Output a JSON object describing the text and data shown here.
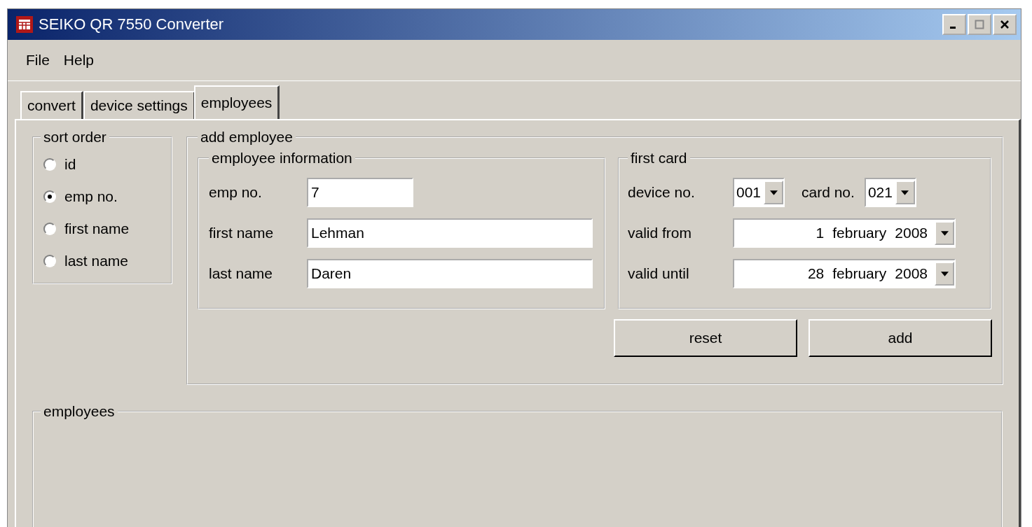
{
  "window": {
    "title": "SEIKO QR 7550 Converter"
  },
  "menu": [
    "File",
    "Help"
  ],
  "tabs": [
    {
      "label": "convert",
      "selected": false
    },
    {
      "label": "device settings",
      "selected": false
    },
    {
      "label": "employees",
      "selected": true
    }
  ],
  "sort_order": {
    "title": "sort order",
    "options": [
      {
        "label": "id",
        "selected": false
      },
      {
        "label": "emp no.",
        "selected": true
      },
      {
        "label": "first name",
        "selected": false
      },
      {
        "label": "last name",
        "selected": false
      }
    ]
  },
  "add_employee": {
    "title": "add employee",
    "employee_information": {
      "title": "employee information",
      "fields": [
        {
          "label": "emp no.",
          "value": "7",
          "kind": "short"
        },
        {
          "label": "first name",
          "value": "Lehman",
          "kind": "long"
        },
        {
          "label": "last name",
          "value": "Daren",
          "kind": "long"
        }
      ]
    },
    "first_card": {
      "title": "first card",
      "device_no": {
        "label": "device no.",
        "value": "001"
      },
      "card_no": {
        "label": "card no.",
        "value": "021"
      },
      "dates": [
        {
          "label": "valid from",
          "day": "1",
          "month": "february",
          "year": "2008"
        },
        {
          "label": "valid until",
          "day": "28",
          "month": "february",
          "year": "2008"
        }
      ]
    },
    "buttons": [
      "reset",
      "add"
    ]
  },
  "employees": {
    "title": "employees"
  }
}
